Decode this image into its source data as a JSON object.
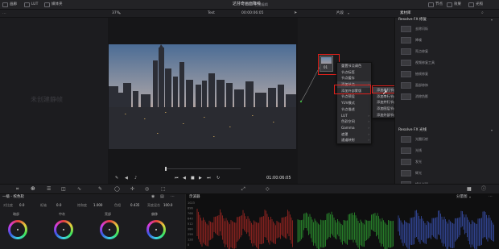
{
  "topbar": {
    "left_items": [
      "画廊",
      "LUT",
      "媒体夹"
    ],
    "project_title": "达芬奇画面降噪",
    "edit_status": "已经编辑",
    "right_items": [
      "节点",
      "效果",
      "光照"
    ]
  },
  "subbar": {
    "zoom": "37%",
    "clip_name": "Test",
    "timecode": "00:00:06:05",
    "node_mode": "片段",
    "lib_tab": "素材库"
  },
  "left_panel": {
    "watermark": "未创建静帧"
  },
  "viewer": {
    "timecode": "01:00:06:05"
  },
  "node": {
    "label": "01"
  },
  "context_menu": {
    "items": [
      {
        "label": "重置节点调色",
        "arrow": false
      },
      {
        "label": "节点标签",
        "arrow": false
      },
      {
        "label": "节点缓存",
        "arrow": false
      },
      {
        "label": "添加节点",
        "arrow": true,
        "highlight": true
      },
      {
        "label": "添加外部蒙版",
        "arrow": false
      },
      {
        "label": "节点预设",
        "arrow": false
      },
      {
        "label": "YUV模式",
        "arrow": false
      },
      {
        "label": "节点描述",
        "arrow": false
      },
      {
        "label": "LUT",
        "arrow": true
      },
      {
        "label": "色彩空间",
        "arrow": true
      },
      {
        "label": "Gamma",
        "arrow": true
      },
      {
        "label": "遮罩",
        "arrow": true
      },
      {
        "label": "通道映射",
        "arrow": true
      }
    ]
  },
  "submenu": {
    "items": [
      {
        "label": "添加串行节点",
        "highlight": true
      },
      {
        "label": "添加串行节点于前"
      },
      {
        "label": "添加并行节点"
      },
      {
        "label": "添加图层节点"
      },
      {
        "label": "添加外部节点"
      }
    ]
  },
  "library": {
    "section1_title": "Resolve FX 修复",
    "section1_items": [
      "去除闪烁",
      "降噪",
      "死点修复",
      "视频修复工具",
      "抽帧修复",
      "面部修饰",
      "消除伪影"
    ],
    "section2_title": "Resolve FX 光线",
    "section2_items": [
      "光圈衍射",
      "光线",
      "发光",
      "辉光",
      "镜头光斑"
    ]
  },
  "color_panel": {
    "title": "一级 - 校色轮",
    "params": [
      {
        "label": "对比度",
        "value": "0.0"
      },
      {
        "label": "枢轴",
        "value": "0.0"
      },
      {
        "label": "饱和度",
        "value": "1.000"
      },
      {
        "label": "色相",
        "value": "0.435"
      },
      {
        "label": "亮度混合",
        "value": "100.0"
      }
    ],
    "wheels": [
      "暗部",
      "中灰",
      "亮部",
      "偏移"
    ]
  },
  "scopes": {
    "title": "示波器",
    "mode": "分量图",
    "scale": [
      "1023",
      "896",
      "768",
      "640",
      "512",
      "384",
      "256",
      "128",
      "0"
    ],
    "colors": {
      "red": "#e0302a",
      "green": "#3ad03c",
      "blue": "#4a6cf0"
    }
  },
  "colors": {
    "accent": "#e0201b",
    "node_link": "#7a7a7a"
  }
}
